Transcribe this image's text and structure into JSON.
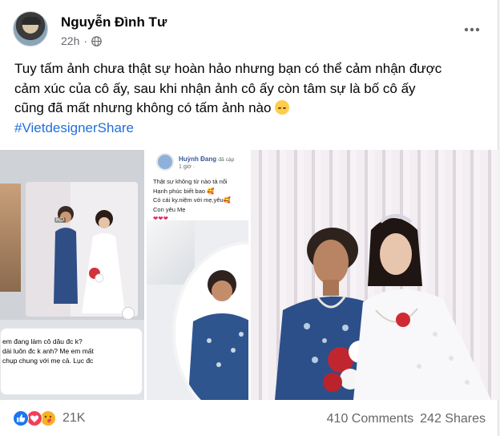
{
  "post": {
    "author": "Nguyễn Đình Tư",
    "time": "22h",
    "separator": "·",
    "text_lines": [
      "Tuy tấm ảnh chưa thật sự hoàn hảo nhưng bạn có thể cảm nhận được",
      "cảm xúc của cô ấy, sau khi nhận ảnh cô ấy còn tâm sự là bố cô ấy",
      "cũng đã mất nhưng không có tấm ảnh nào"
    ],
    "hashtag": "#VietdesignerShare"
  },
  "icons": {
    "avatar": "avatar",
    "privacy": "globe-icon",
    "more": "more-icon",
    "text_emoji": "pensive-face-emoji"
  },
  "media": {
    "screenshot_chat": {
      "hd_badge": "HD",
      "lines": [
        "em đang làm cô dâu đc k?",
        "dài luôn đc k anh? Mẹ em mất",
        "chụp chung với mẹ cả. Lục đc"
      ]
    },
    "screenshot_post": {
      "name": "Huỳnh Đang",
      "name_suffix": "đã cập",
      "time": "1 giờ ·",
      "lines": [
        "Thật sự không từ nào tả nổi",
        "Hạnh phúc biết bao 🥰",
        "Có cái ky.niệm với mẹ,yêu🥰",
        "Con yêu Mẹ"
      ],
      "hearts": "❤❤❤"
    }
  },
  "footer": {
    "reaction_count": "21K",
    "comments": "410 Comments",
    "shares": "242 Shares"
  },
  "colors": {
    "like_blue": "#1877f2",
    "love_red": "#f33e58",
    "care_yellow": "#f7b125",
    "link_blue": "#216fdb",
    "secondary_text": "#65676b"
  }
}
